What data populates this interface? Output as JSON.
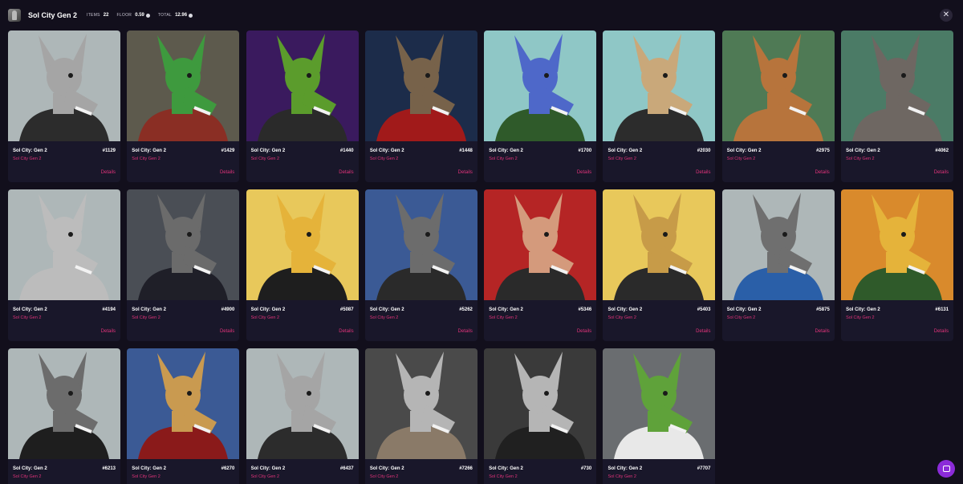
{
  "header": {
    "title": "Sol City Gen 2",
    "items_label": "ITEMS",
    "items_value": "22",
    "floor_label": "FLOOR",
    "floor_value": "0.59",
    "total_label": "TOTAL",
    "total_value": "12.96",
    "close_icon": "close-icon"
  },
  "cards": [
    {
      "name": "Sol City: Gen 2",
      "number": "#1129",
      "collection": "Sol City Gen 2",
      "details": "Details",
      "bg": "#aeb7b8",
      "fur": "#a5a5a5",
      "shirt": "#2c2c2c"
    },
    {
      "name": "Sol City: Gen 2",
      "number": "#1429",
      "collection": "Sol City Gen 2",
      "details": "Details",
      "bg": "#5d5a4d",
      "fur": "#3e9a3e",
      "shirt": "#8a2e24"
    },
    {
      "name": "Sol City: Gen 2",
      "number": "#1440",
      "collection": "Sol City Gen 2",
      "details": "Details",
      "bg": "#3a1a5e",
      "fur": "#5b9c2c",
      "shirt": "#2a2a2a"
    },
    {
      "name": "Sol City: Gen 2",
      "number": "#1448",
      "collection": "Sol City Gen 2",
      "details": "Details",
      "bg": "#1c2c4a",
      "fur": "#77624a",
      "shirt": "#a11a1a"
    },
    {
      "name": "Sol City: Gen 2",
      "number": "#1700",
      "collection": "Sol City Gen 2",
      "details": "Details",
      "bg": "#8fc7c6",
      "fur": "#4e68c9",
      "shirt": "#2f5a2a"
    },
    {
      "name": "Sol City: Gen 2",
      "number": "#2030",
      "collection": "Sol City Gen 2",
      "details": "Details",
      "bg": "#8fc7c6",
      "fur": "#c9a87a",
      "shirt": "#2c2c2c"
    },
    {
      "name": "Sol City: Gen 2",
      "number": "#2975",
      "collection": "Sol City Gen 2",
      "details": "Details",
      "bg": "#4f7a55",
      "fur": "#b7743c",
      "shirt": "#b7743c"
    },
    {
      "name": "Sol City: Gen 2",
      "number": "#4062",
      "collection": "Sol City Gen 2",
      "details": "Details",
      "bg": "#4b7b66",
      "fur": "#6e6762",
      "shirt": "#6e6762"
    },
    {
      "name": "Sol City: Gen 2",
      "number": "#4194",
      "collection": "Sol City Gen 2",
      "details": "Details",
      "bg": "#aeb7b8",
      "fur": "#bcbcbc",
      "shirt": "#bcbcbc"
    },
    {
      "name": "Sol City: Gen 2",
      "number": "#4900",
      "collection": "Sol City Gen 2",
      "details": "Details",
      "bg": "#4a4e55",
      "fur": "#6b6b6b",
      "shirt": "#1f1f28"
    },
    {
      "name": "Sol City: Gen 2",
      "number": "#5087",
      "collection": "Sol City Gen 2",
      "details": "Details",
      "bg": "#e8c85b",
      "fur": "#e5b33a",
      "shirt": "#1e1e1e"
    },
    {
      "name": "Sol City: Gen 2",
      "number": "#5262",
      "collection": "Sol City Gen 2",
      "details": "Details",
      "bg": "#3b5a95",
      "fur": "#6c6c6c",
      "shirt": "#2a2a2a"
    },
    {
      "name": "Sol City: Gen 2",
      "number": "#5346",
      "collection": "Sol City Gen 2",
      "details": "Details",
      "bg": "#b52525",
      "fur": "#d49a7c",
      "shirt": "#2a2a2a"
    },
    {
      "name": "Sol City: Gen 2",
      "number": "#5403",
      "collection": "Sol City Gen 2",
      "details": "Details",
      "bg": "#e8c85b",
      "fur": "#c79b48",
      "shirt": "#2a2a2a"
    },
    {
      "name": "Sol City: Gen 2",
      "number": "#5875",
      "collection": "Sol City Gen 2",
      "details": "Details",
      "bg": "#aeb7b8",
      "fur": "#6f6f6f",
      "shirt": "#2a5fa8"
    },
    {
      "name": "Sol City: Gen 2",
      "number": "#6131",
      "collection": "Sol City Gen 2",
      "details": "Details",
      "bg": "#d98a2c",
      "fur": "#e5b33a",
      "shirt": "#2f5a2a"
    },
    {
      "name": "Sol City: Gen 2",
      "number": "#6213",
      "collection": "Sol City Gen 2",
      "details": "Details",
      "bg": "#aeb7b8",
      "fur": "#6c6c6c",
      "shirt": "#1e1e1e"
    },
    {
      "name": "Sol City: Gen 2",
      "number": "#6270",
      "collection": "Sol City Gen 2",
      "details": "Details",
      "bg": "#3b5a95",
      "fur": "#c99a50",
      "shirt": "#8a1a1a"
    },
    {
      "name": "Sol City: Gen 2",
      "number": "#6437",
      "collection": "Sol City Gen 2",
      "details": "Details",
      "bg": "#aeb7b8",
      "fur": "#a5a5a5",
      "shirt": "#2c2c2c"
    },
    {
      "name": "Sol City: Gen 2",
      "number": "#7266",
      "collection": "Sol City Gen 2",
      "details": "Details",
      "bg": "#4a4a4a",
      "fur": "#b5b5b5",
      "shirt": "#8a7a68"
    },
    {
      "name": "Sol City: Gen 2",
      "number": "#730",
      "collection": "Sol City Gen 2",
      "details": "Details",
      "bg": "#3a3a3a",
      "fur": "#b5b5b5",
      "shirt": "#202020"
    },
    {
      "name": "Sol City: Gen 2",
      "number": "#7707",
      "collection": "Sol City Gen 2",
      "details": "Details",
      "bg": "#6a6d70",
      "fur": "#5fa23a",
      "shirt": "#e8e8e8"
    }
  ],
  "chat": {
    "icon": "chat-icon"
  }
}
